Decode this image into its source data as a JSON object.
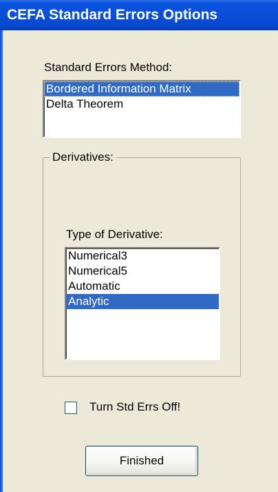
{
  "window": {
    "title": "CEFA Standard Errors Options"
  },
  "se_method": {
    "label": "Standard Errors Method:",
    "items": [
      "Bordered Information Matrix",
      "Delta Theorem"
    ],
    "selected_index": 0
  },
  "derivatives": {
    "group_title": "Derivatives:",
    "type_label": "Type of Derivative:",
    "items": [
      "Numerical3",
      "Numerical5",
      "Automatic",
      "Analytic"
    ],
    "selected_index": 3
  },
  "turn_off": {
    "label": "Turn Std Errs Off!",
    "checked": false
  },
  "finished_button": {
    "label": "Finished"
  },
  "colors": {
    "titlebar": "#0a4fd8",
    "selection": "#316ac5",
    "dialog_bg": "#ece9d8"
  }
}
